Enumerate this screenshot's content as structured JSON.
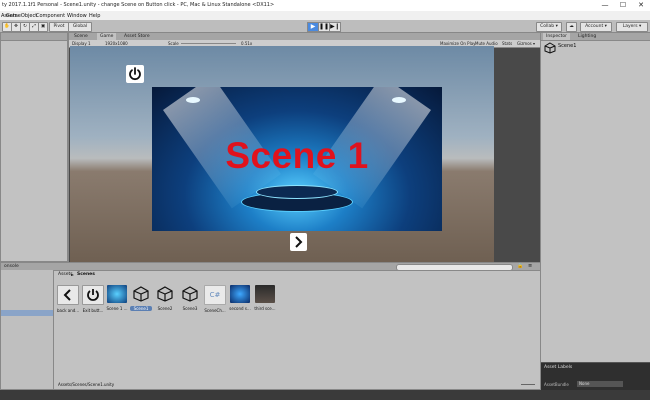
{
  "window": {
    "title": "ty 2017.1.1f1 Personal - Scene1.unity - change Scene on Button click - PC, Mac & Linux Standalone <DX11>",
    "buttons": [
      "—",
      "☐",
      "✕"
    ]
  },
  "menu": [
    "Assets",
    "GameObject",
    "Component",
    "Window",
    "Help"
  ],
  "toolbar": {
    "pivot_label": "Pivot",
    "global_label": "Global",
    "collab_label": "Collab ▾",
    "account_label": "Account ▾",
    "layers_label": "Layers ▾"
  },
  "scene_tabs": [
    "Scene",
    "Game",
    "Asset Store"
  ],
  "game_bar": {
    "display": "Display 1",
    "resolution": "1920x1080",
    "scale_label": "Scale",
    "scale_value": "0.51x",
    "maximize": "Maximize On Play",
    "mute": "Mute Audio",
    "stats": "Stats",
    "gizmos": "Gizmos ▾"
  },
  "game": {
    "scene_title": "Scene 1",
    "power_icon": "power-icon",
    "next_icon": "chevron-right-icon"
  },
  "inspector": {
    "tabs": [
      "Inspector",
      "Lighting"
    ],
    "object_name": "Scene1"
  },
  "project": {
    "tab_console": "onsole",
    "breadcrumb_root": "Assets",
    "breadcrumb_sep": "►",
    "breadcrumb_folder": "Scenes",
    "assets": [
      {
        "label": "back and...",
        "kind": "back-icon"
      },
      {
        "label": "Exit butt...",
        "kind": "power-icon"
      },
      {
        "label": "Scene 1 ...",
        "kind": "image"
      },
      {
        "label": "Scene1",
        "kind": "unity-icon",
        "selected": true
      },
      {
        "label": "Scene2",
        "kind": "unity-icon"
      },
      {
        "label": "Scene3",
        "kind": "unity-icon"
      },
      {
        "label": "SceneCh...",
        "kind": "cs-icon"
      },
      {
        "label": "second s...",
        "kind": "image"
      },
      {
        "label": "third sce...",
        "kind": "image-dark"
      }
    ],
    "footer_path": "Assets/Scenes/Scene1.unity"
  },
  "asset_labels": {
    "title": "Asset Labels",
    "bundle_label": "AssetBundle",
    "bundle_value": "None"
  },
  "colors": {
    "scene_title": "#e0121d",
    "play_active": "#4a8ae0"
  }
}
